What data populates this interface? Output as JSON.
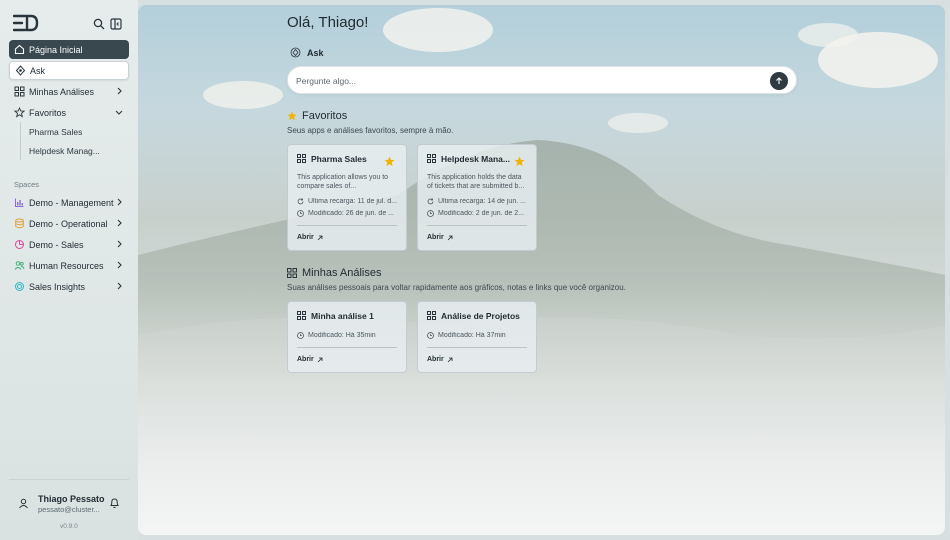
{
  "sidebar": {
    "logo_icon": "ed-logo",
    "items": [
      {
        "label": "Página Inicial",
        "icon": "home-icon"
      },
      {
        "label": "Ask",
        "icon": "ask-icon"
      },
      {
        "label": "Minhas Análises",
        "icon": "grid-icon"
      },
      {
        "label": "Favoritos",
        "icon": "star-icon"
      }
    ],
    "favorites": [
      "Pharma Sales",
      "Helpdesk Manag..."
    ],
    "spaces_label": "Spaces",
    "spaces": [
      {
        "label": "Demo - Management",
        "color": "#8a6bd6"
      },
      {
        "label": "Demo - Operational",
        "color": "#e0a13a"
      },
      {
        "label": "Demo - Sales",
        "color": "#d94a9b"
      },
      {
        "label": "Human Resources",
        "color": "#3bb27a"
      },
      {
        "label": "Sales Insights",
        "color": "#2fb6c4"
      }
    ],
    "user": {
      "name": "Thiago Pessato",
      "email": "pessato@cluster..."
    },
    "version": "v0.9.0"
  },
  "main": {
    "greeting": "Olá, Thiago!",
    "ask_label": "Ask",
    "ask_placeholder": "Pergunte algo...",
    "favorites": {
      "title": "Favoritos",
      "description": "Seus apps e análises favoritos, sempre à mão.",
      "cards": [
        {
          "title": "Pharma Sales",
          "description": "This application allows you to compare sales of...",
          "reload": "Última recarga: 11 de jul. d...",
          "modified": "Modificado: 26 de jun. de ...",
          "open": "Abrir"
        },
        {
          "title": "Helpdesk Mana...",
          "description": "This application holds the data of tickets that are submitted b...",
          "reload": "Última recarga: 14 de jun. ...",
          "modified": "Modificado: 2 de jun. de 2...",
          "open": "Abrir"
        }
      ]
    },
    "analyses": {
      "title": "Minhas Análises",
      "description": "Suas análises pessoais para voltar rapidamente aos gráficos, notas e links que você organizou.",
      "cards": [
        {
          "title": "Minha análise 1",
          "modified": "Modificado: Há 35min",
          "open": "Abrir"
        },
        {
          "title": "Análise de Projetos",
          "modified": "Modificado: Há 37min",
          "open": "Abrir"
        }
      ]
    }
  },
  "colors": {
    "accent_dark": "#39474f",
    "star": "#f0b400"
  }
}
